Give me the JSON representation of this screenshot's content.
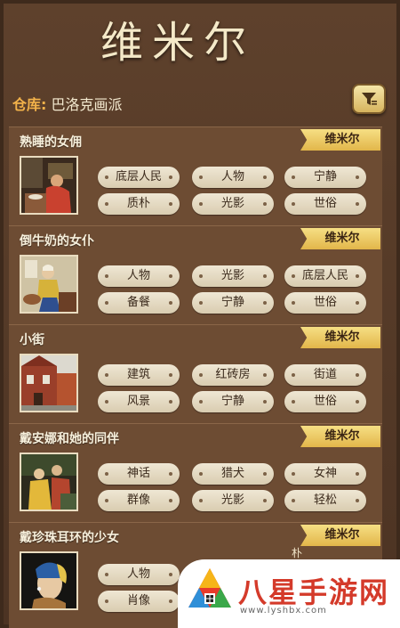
{
  "title": "维米尔",
  "repository": {
    "label": "仓库:",
    "value": "巴洛克画派"
  },
  "cards": [
    {
      "name": "熟睡的女佣",
      "artist": "维米尔",
      "tags": [
        "底层人民",
        "人物",
        "宁静",
        "质朴",
        "光影",
        "世俗"
      ]
    },
    {
      "name": "倒牛奶的女仆",
      "artist": "维米尔",
      "tags": [
        "人物",
        "光影",
        "底层人民",
        "备餐",
        "宁静",
        "世俗"
      ]
    },
    {
      "name": "小街",
      "artist": "维米尔",
      "tags": [
        "建筑",
        "红砖房",
        "街道",
        "风景",
        "宁静",
        "世俗"
      ]
    },
    {
      "name": "戴安娜和她的同伴",
      "artist": "维米尔",
      "tags": [
        "神话",
        "猎犬",
        "女神",
        "群像",
        "光影",
        "轻松"
      ]
    },
    {
      "name": "戴珍珠耳环的少女",
      "artist": "维米尔",
      "tags": [
        "人物",
        "",
        "",
        "肖像",
        "",
        ""
      ]
    }
  ],
  "overflow_text": "朴",
  "watermark": {
    "text": "八星手游网",
    "url": "www.lyshbx.com"
  },
  "colors": {
    "accent": "#f2b24a",
    "ribbon": "#e2b64a",
    "background": "#5a3e2b"
  }
}
